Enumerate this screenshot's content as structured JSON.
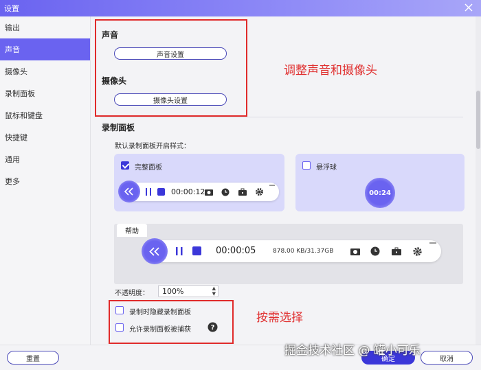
{
  "window": {
    "title": "设置"
  },
  "sidebar": {
    "items": [
      {
        "label": "输出"
      },
      {
        "label": "声音"
      },
      {
        "label": "摄像头"
      },
      {
        "label": "录制面板"
      },
      {
        "label": "鼠标和键盘"
      },
      {
        "label": "快捷键"
      },
      {
        "label": "通用"
      },
      {
        "label": "更多"
      }
    ],
    "active_index": 1
  },
  "sound": {
    "title": "声音",
    "button": "声音设置"
  },
  "camera": {
    "title": "摄像头",
    "button": "摄像头设置"
  },
  "panel": {
    "title": "录制面板",
    "default_style_label": "默认录制面板开启样式：",
    "full_panel": {
      "label": "完整面板",
      "checked": true,
      "time": "00:00:12"
    },
    "float_ball": {
      "label": "悬浮球",
      "checked": false,
      "time": "00:24"
    },
    "help": {
      "tab": "帮助",
      "time": "00:00:05",
      "storage": "878.00 KB/31.37GB"
    },
    "opacity": {
      "label": "不透明度：",
      "value": "100%"
    },
    "options": [
      {
        "label": "录制时隐藏录制面板",
        "checked": false
      },
      {
        "label": "允许录制面板被捕获",
        "checked": false
      }
    ]
  },
  "annotations": {
    "top": "调整声音和摄像头",
    "bottom": "按需选择"
  },
  "footer": {
    "reset": "重置",
    "ok": "确定",
    "cancel": "取消"
  },
  "watermark": "掘金技术社区 @ 罐小可乐",
  "colors": {
    "accent": "#6a63f0",
    "annotation": "#e02a2a"
  },
  "icons": [
    "close-icon",
    "double-chevron-left-icon",
    "pause-icon",
    "stop-icon",
    "camera-icon",
    "clock-icon",
    "toolbox-icon",
    "gear-icon",
    "minimize-icon",
    "help-icon",
    "checkmark-icon"
  ]
}
